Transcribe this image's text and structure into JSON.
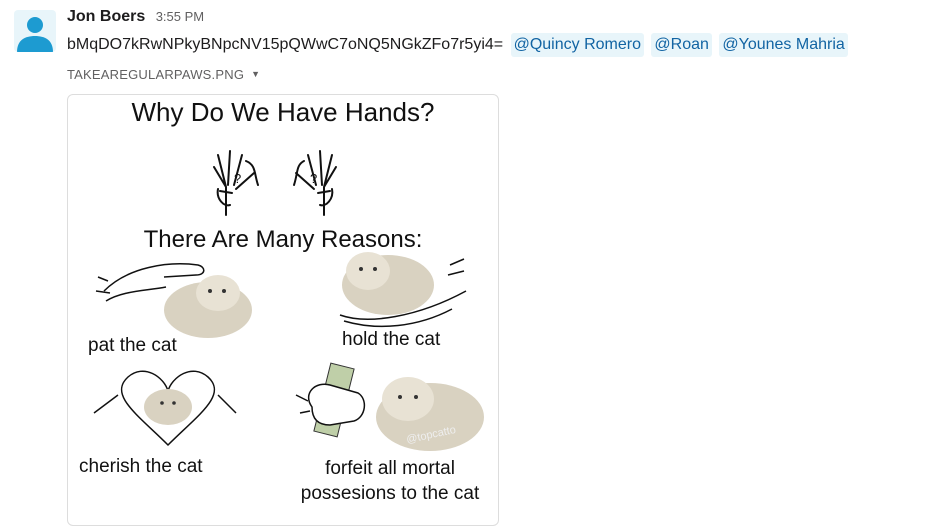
{
  "message": {
    "author": "Jon Boers",
    "timestamp": "3:55 PM",
    "text": "bMqDO7kRwNPkyBNpcNV15pQWwC7oNQ5NGkZFo7r5yi4=",
    "mentions": [
      "@Quincy Romero",
      "@Roan",
      "@Younes Mahria"
    ]
  },
  "attachment": {
    "filename": "TAKEAREGULARPAWS.PNG",
    "caret_icon": "caret-down-icon"
  },
  "meme": {
    "title": "Why Do We Have Hands?",
    "subtitle": "There Are Many Reasons:",
    "captions": {
      "pat": "pat the cat",
      "hold": "hold the cat",
      "cherish": "cherish the cat",
      "forfeit_line1": "forfeit all mortal",
      "forfeit_line2": "possesions to the cat"
    },
    "watermark": "@topcatto"
  },
  "colors": {
    "mention_bg": "#e8f5fa",
    "mention_text": "#1264a3",
    "avatar": "#1d9bd1"
  }
}
